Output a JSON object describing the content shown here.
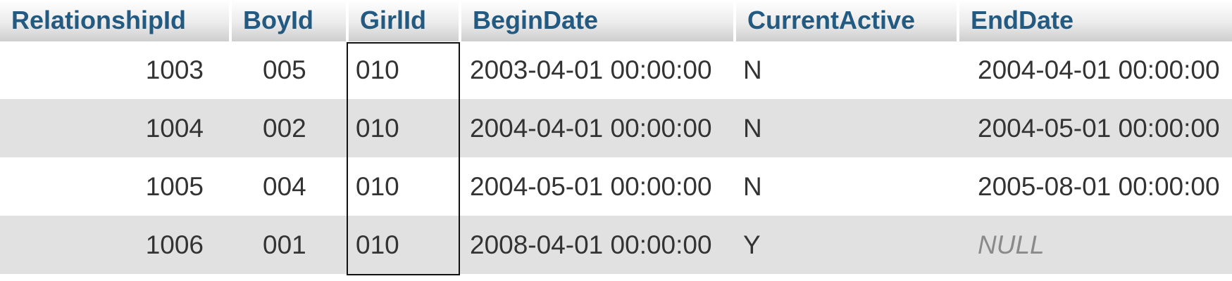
{
  "table": {
    "headers": [
      "RelationshipId",
      "BoyId",
      "GirlId",
      "BeginDate",
      "CurrentActive",
      "EndDate"
    ],
    "rows": [
      [
        "1003",
        "005",
        "010",
        "2003-04-01 00:00:00",
        "N",
        "2004-04-01 00:00:00"
      ],
      [
        "1004",
        "002",
        "010",
        "2004-04-01 00:00:00",
        "N",
        "2004-05-01 00:00:00"
      ],
      [
        "1005",
        "004",
        "010",
        "2004-05-01 00:00:00",
        "N",
        "2005-08-01 00:00:00"
      ],
      [
        "1006",
        "001",
        "010",
        "2008-04-01 00:00:00",
        "Y",
        "NULL"
      ]
    ]
  },
  "colors": {
    "header_text": "#235a81",
    "row_alt": "#e1e1e1",
    "cell_text": "#333333",
    "null_text": "#8a8a8a",
    "highlight_border": "#111111"
  }
}
